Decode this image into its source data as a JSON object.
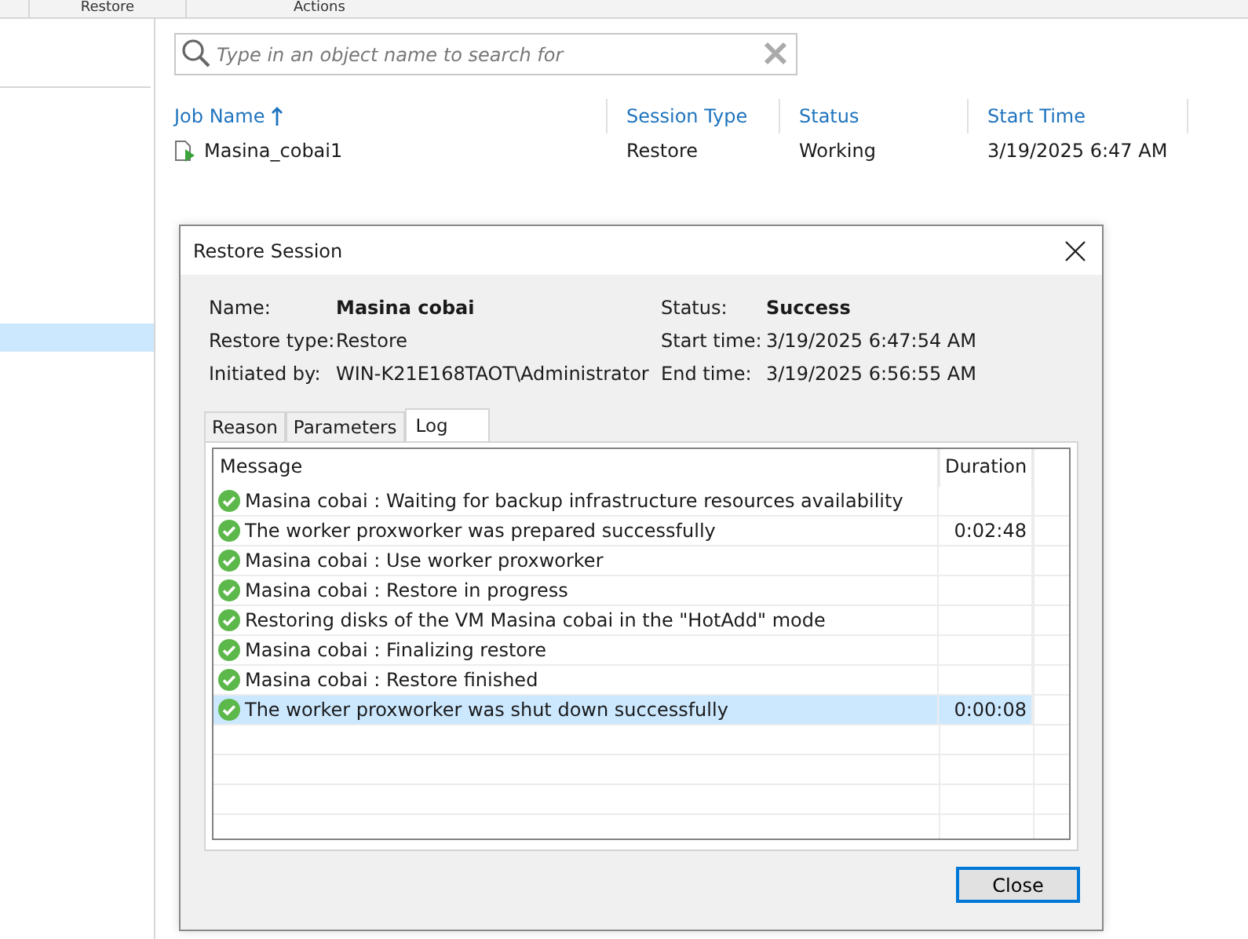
{
  "ribbon": {
    "groups": [
      "Restore",
      "Actions"
    ]
  },
  "search": {
    "placeholder": "Type in an object name to search for"
  },
  "jobs": {
    "columns": [
      {
        "label": "Job Name",
        "sorted": true
      },
      {
        "label": "Session Type",
        "sorted": false
      },
      {
        "label": "Status",
        "sorted": false
      },
      {
        "label": "Start Time",
        "sorted": false
      }
    ],
    "rows": [
      {
        "cells": [
          "Masina_cobai1",
          "Restore",
          "Working",
          "3/19/2025 6:47 AM"
        ]
      }
    ]
  },
  "dialog": {
    "title": "Restore Session",
    "fields_left": [
      {
        "label": "Name:",
        "value": "Masina cobai",
        "bold": true
      },
      {
        "label": "Restore type:",
        "value": "Restore",
        "bold": false
      },
      {
        "label": "Initiated by:",
        "value": "WIN-K21E168TAOT\\Administrator",
        "bold": false
      }
    ],
    "fields_right": [
      {
        "label": "Status:",
        "value": "Success",
        "bold": true
      },
      {
        "label": "Start time:",
        "value": "3/19/2025 6:47:54 AM",
        "bold": false
      },
      {
        "label": "End time:",
        "value": "3/19/2025 6:56:55 AM",
        "bold": false
      }
    ],
    "tabs": [
      {
        "label": "Reason",
        "selected": false
      },
      {
        "label": "Parameters",
        "selected": false
      },
      {
        "label": "Log",
        "selected": true
      }
    ],
    "log": {
      "columns": [
        "Message",
        "Duration"
      ],
      "rows": [
        {
          "message": "Masina cobai : Waiting for backup infrastructure resources availability",
          "duration": "",
          "selected": false
        },
        {
          "message": "The worker proxworker was prepared successfully",
          "duration": "0:02:48",
          "selected": false
        },
        {
          "message": "Masina cobai : Use worker proxworker",
          "duration": "",
          "selected": false
        },
        {
          "message": "Masina cobai : Restore in progress",
          "duration": "",
          "selected": false
        },
        {
          "message": "Restoring disks of the VM Masina cobai in the \"HotAdd\" mode",
          "duration": "",
          "selected": false
        },
        {
          "message": "Masina cobai : Finalizing restore",
          "duration": "",
          "selected": false
        },
        {
          "message": "Masina cobai : Restore finished",
          "duration": "",
          "selected": false
        },
        {
          "message": "The worker proxworker was shut down successfully",
          "duration": "0:00:08",
          "selected": true
        }
      ]
    },
    "buttons": [
      "Close"
    ]
  }
}
